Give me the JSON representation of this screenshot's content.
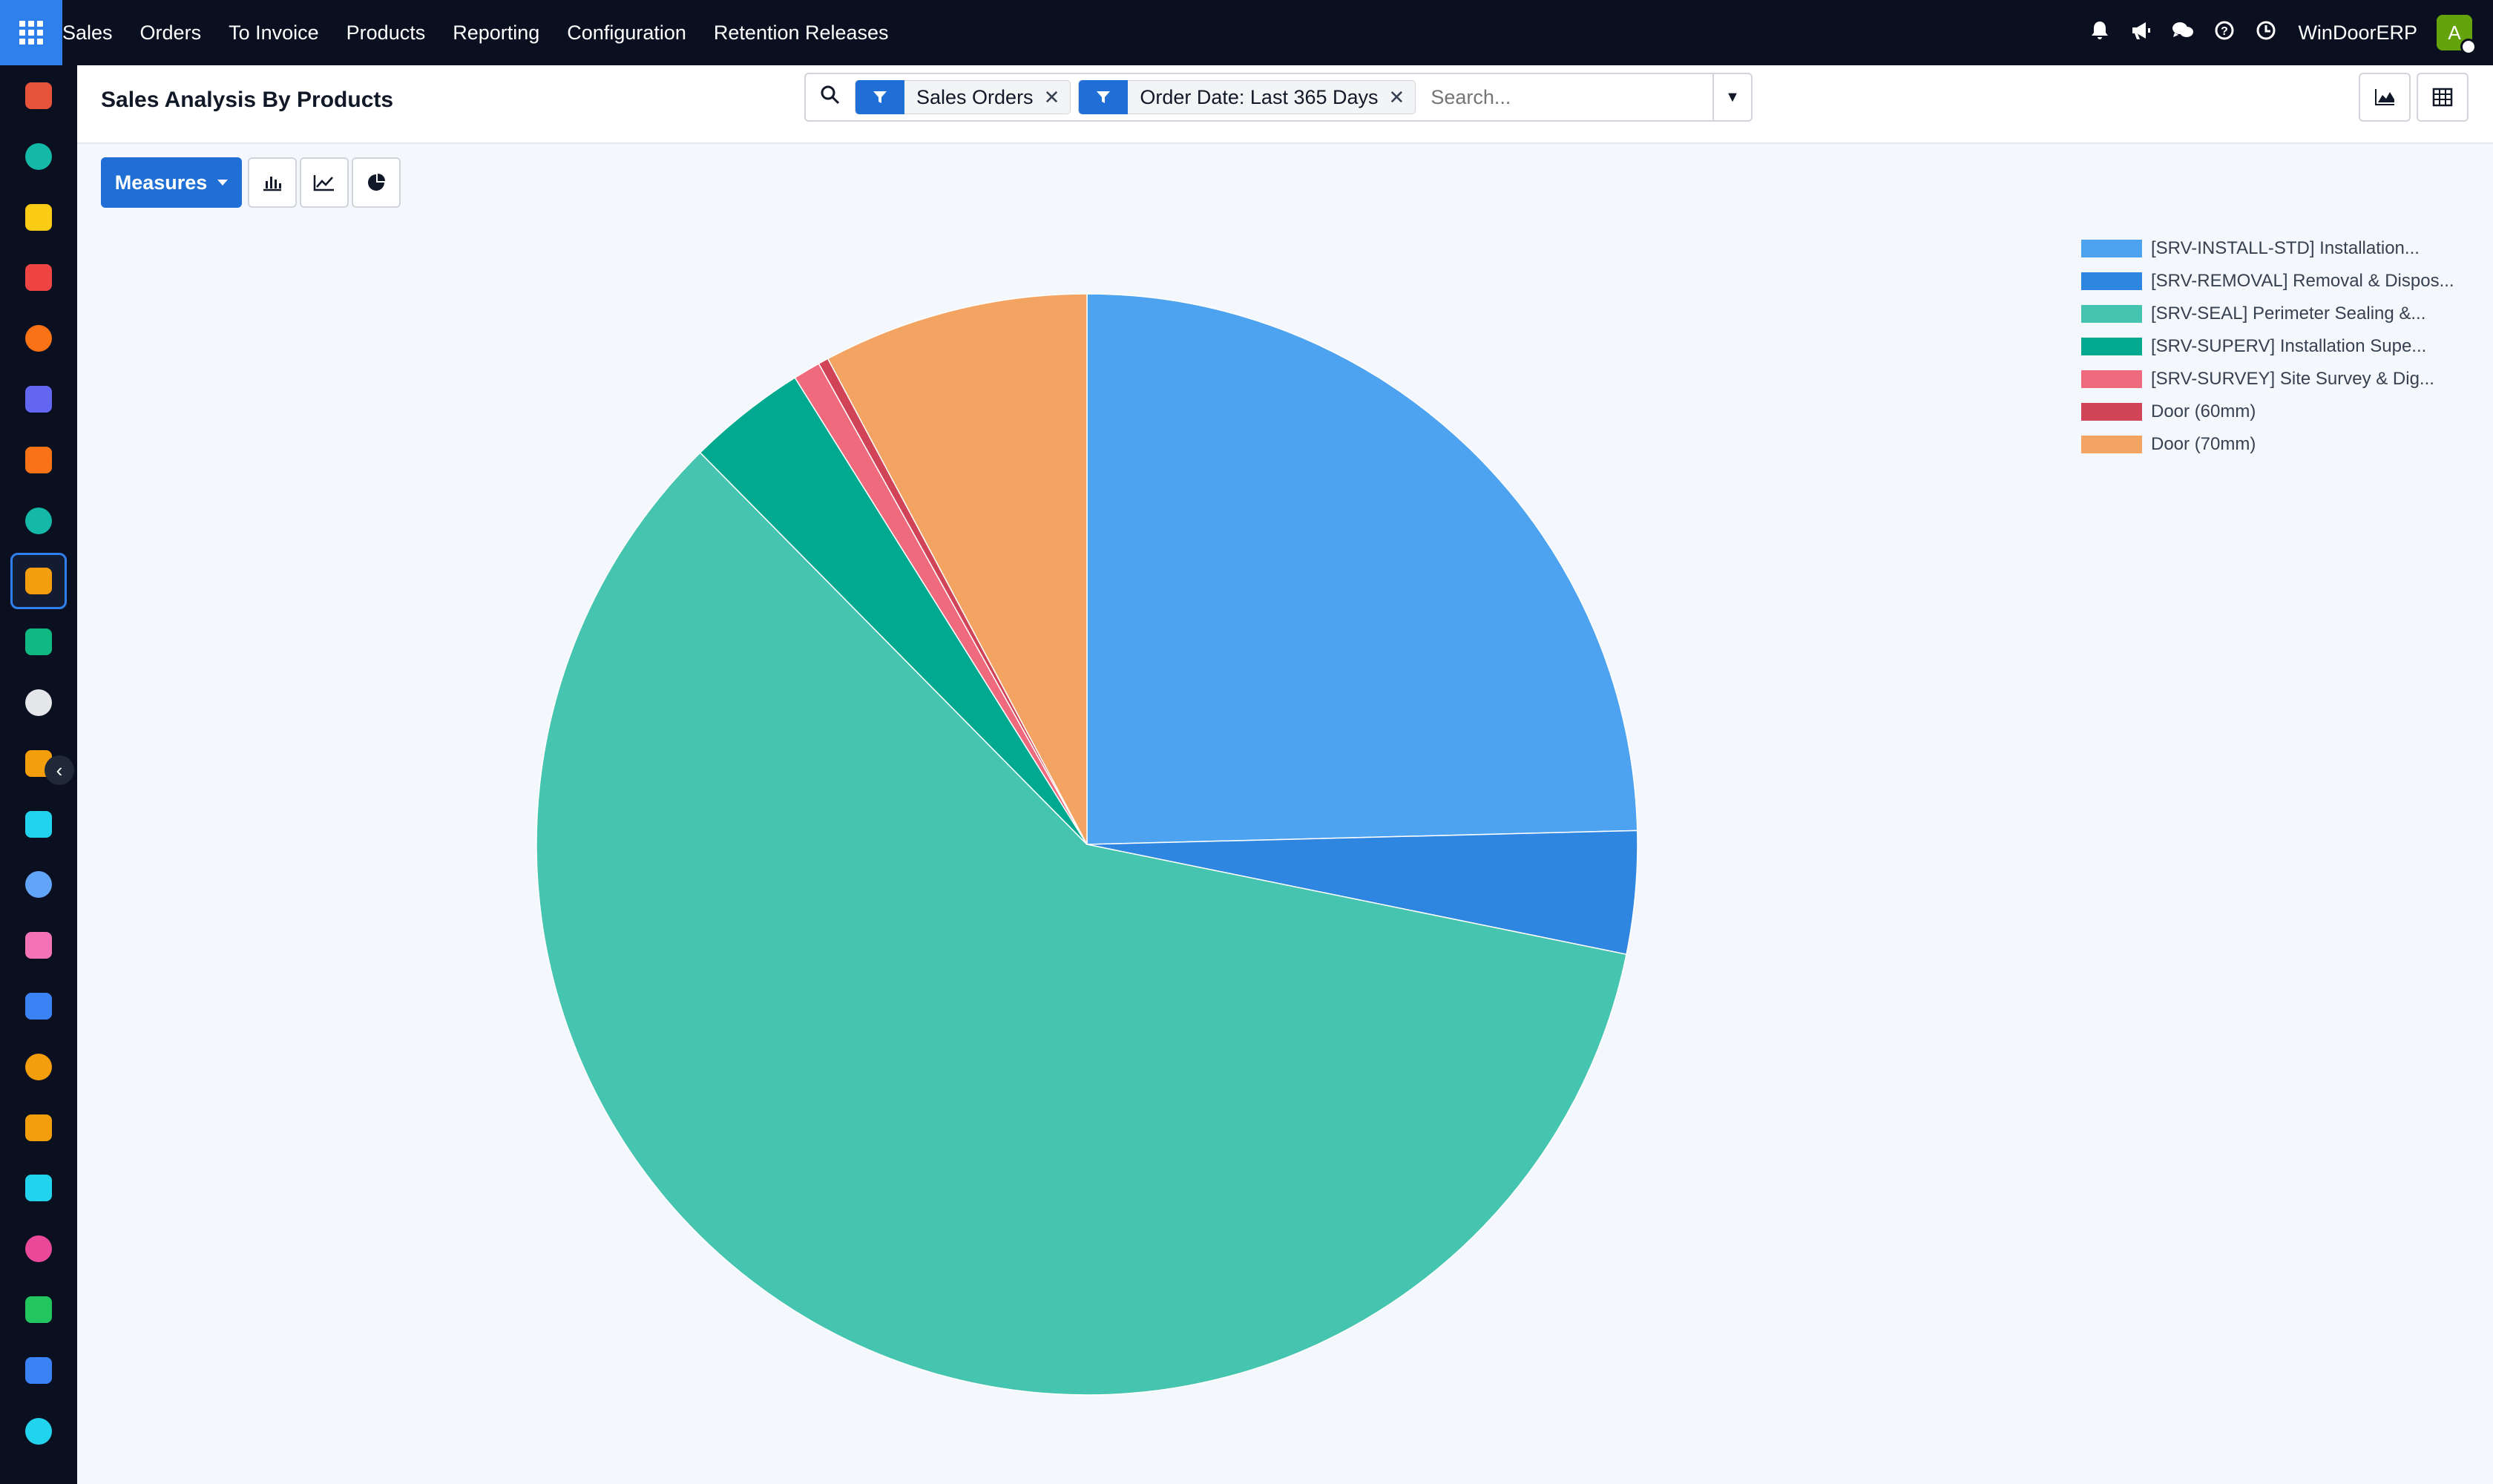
{
  "topbar": {
    "menu": [
      "Sales",
      "Orders",
      "To Invoice",
      "Products",
      "Reporting",
      "Configuration",
      "Retention Releases"
    ],
    "company": "WinDoorERP",
    "avatar_letter": "A"
  },
  "page": {
    "title": "Sales Analysis By Products"
  },
  "search": {
    "facets": [
      {
        "label": "Sales Orders"
      },
      {
        "label": "Order Date: Last 365 Days"
      }
    ],
    "placeholder": "Search..."
  },
  "toolbar": {
    "measures_label": "Measures"
  },
  "sidebar": {
    "apps": [
      {
        "icon": "hexagon-app-icon",
        "color": "#e8543b"
      },
      {
        "icon": "sales-app-icon",
        "color": "#14b8a6"
      },
      {
        "icon": "send-app-icon",
        "color": "#facc15"
      },
      {
        "icon": "pie-app-icon",
        "color": "#ef4444"
      },
      {
        "icon": "gear-app-icon",
        "color": "#f97316"
      },
      {
        "icon": "mail-app-icon",
        "color": "#6366f1"
      },
      {
        "icon": "chat-app-icon",
        "color": "#f97316"
      },
      {
        "icon": "sales-app-icon-2",
        "color": "#14b8a6"
      },
      {
        "icon": "reporting-app-icon",
        "color": "#f59e0b"
      },
      {
        "icon": "contacts-app-icon",
        "color": "#10b981"
      },
      {
        "icon": "inventory-app-icon",
        "color": "#e5e7eb"
      },
      {
        "icon": "tools-app-icon",
        "color": "#f59e0b"
      },
      {
        "icon": "check-app-icon",
        "color": "#22d3ee"
      },
      {
        "icon": "knowledge-app-icon",
        "color": "#60a5fa"
      },
      {
        "icon": "package-app-icon",
        "color": "#f472b6"
      },
      {
        "icon": "invoice-app-icon",
        "color": "#3b82f6"
      },
      {
        "icon": "team-app-icon",
        "color": "#f59e0b"
      },
      {
        "icon": "calendar-app-icon",
        "color": "#f59e0b"
      },
      {
        "icon": "sign-app-icon",
        "color": "#22d3ee"
      },
      {
        "icon": "dashboard-app-icon",
        "color": "#ec4899"
      },
      {
        "icon": "whatsapp-app-icon",
        "color": "#22c55e"
      },
      {
        "icon": "timer-app-icon",
        "color": "#3b82f6"
      },
      {
        "icon": "sphere-app-icon",
        "color": "#22d3ee"
      }
    ],
    "active_index": 8
  },
  "chart_data": {
    "type": "pie",
    "series": [
      {
        "name": "[SRV-INSTALL-STD] Installation...",
        "value": 24.6,
        "color": "#4da3f0"
      },
      {
        "name": "[SRV-REMOVAL] Removal & Dispos...",
        "value": 3.6,
        "color": "#2e86e0"
      },
      {
        "name": "[SRV-SEAL] Perimeter Sealing &...",
        "value": 59.4,
        "color": "#45c5b0"
      },
      {
        "name": "[SRV-SUPERV] Installation Supe...",
        "value": 3.5,
        "color": "#00a98f"
      },
      {
        "name": "[SRV-SURVEY] Site Survey & Dig...",
        "value": 0.8,
        "color": "#ee6a7c"
      },
      {
        "name": "Door (60mm)",
        "value": 0.3,
        "color": "#d14457"
      },
      {
        "name": "Door (70mm)",
        "value": 7.8,
        "color": "#f3a462"
      }
    ],
    "legend_position": "top-right"
  }
}
